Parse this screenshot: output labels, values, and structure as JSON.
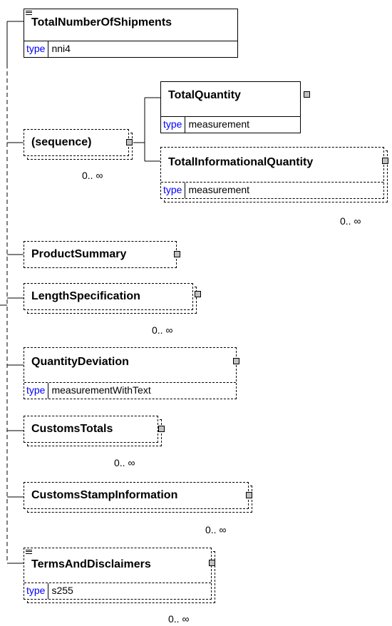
{
  "nodes": {
    "total_number_of_shipments": {
      "name": "TotalNumberOfShipments",
      "type_key": "type",
      "type_value": "nni4"
    },
    "sequence": {
      "name": "(sequence)",
      "cardinality": "0.. ∞"
    },
    "total_quantity": {
      "name": "TotalQuantity",
      "type_key": "type",
      "type_value": "measurement"
    },
    "total_informational_quantity": {
      "name": "TotalInformationalQuantity",
      "type_key": "type",
      "type_value": "measurement",
      "cardinality": "0.. ∞"
    },
    "product_summary": {
      "name": "ProductSummary"
    },
    "length_specification": {
      "name": "LengthSpecification",
      "cardinality": "0.. ∞"
    },
    "quantity_deviation": {
      "name": "QuantityDeviation",
      "type_key": "type",
      "type_value": "measurementWithText"
    },
    "customs_totals": {
      "name": "CustomsTotals",
      "cardinality": "0.. ∞"
    },
    "customs_stamp_information": {
      "name": "CustomsStampInformation",
      "cardinality": "0.. ∞"
    },
    "terms_and_disclaimers": {
      "name": "TermsAndDisclaimers",
      "type_key": "type",
      "type_value": "s255",
      "cardinality": "0.. ∞"
    }
  }
}
